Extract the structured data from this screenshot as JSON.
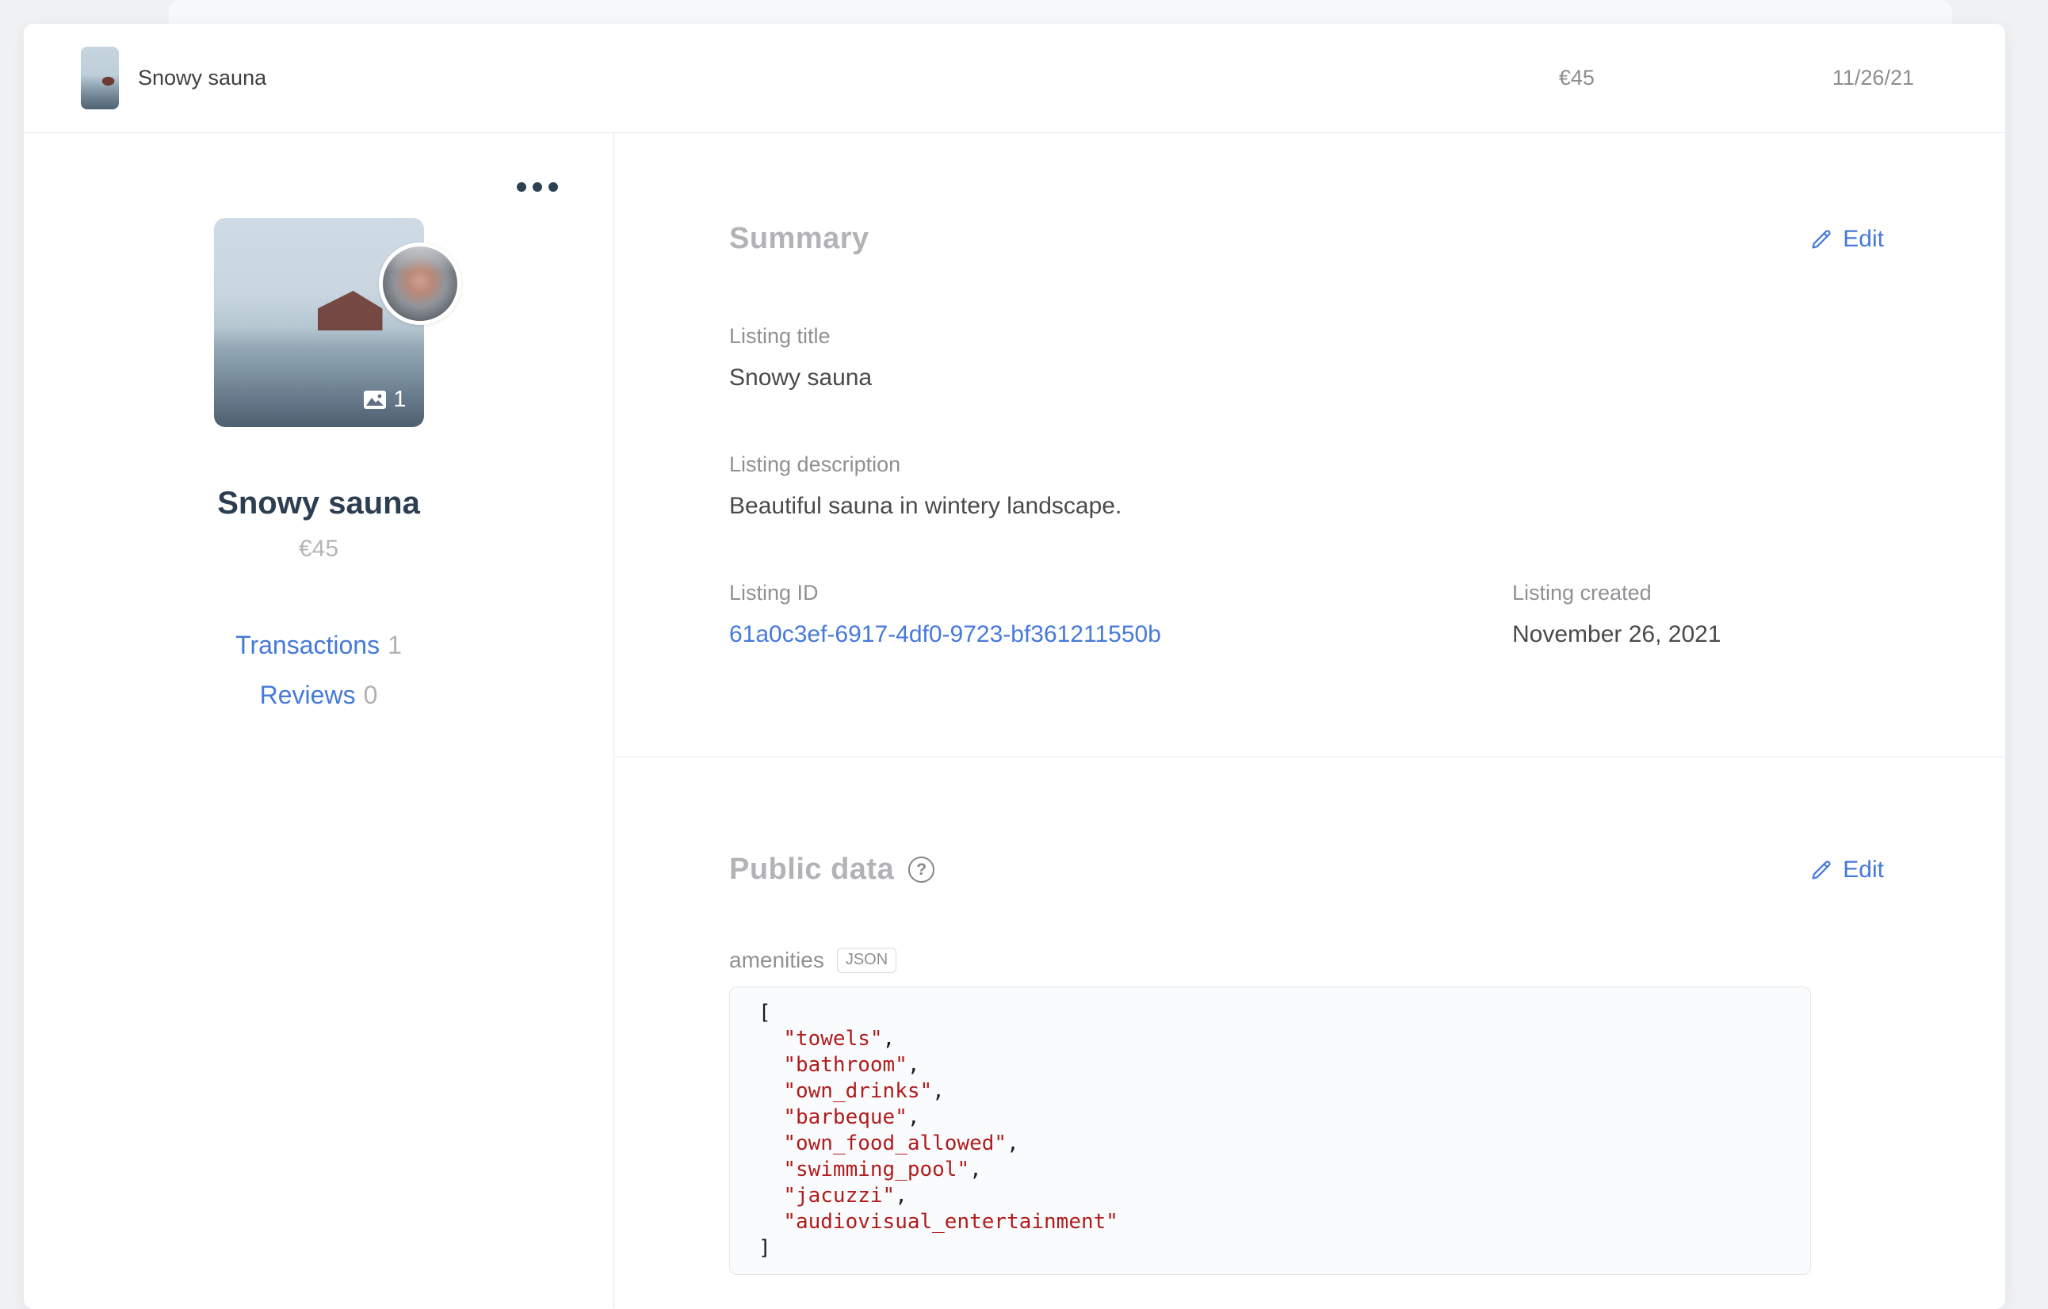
{
  "header": {
    "title": "Snowy sauna",
    "price": "€45",
    "date": "11/26/21"
  },
  "sidebar": {
    "image_count": "1",
    "title": "Snowy sauna",
    "price": "€45",
    "links": [
      {
        "label": "Transactions",
        "count": "1"
      },
      {
        "label": "Reviews",
        "count": "0"
      }
    ]
  },
  "summary": {
    "heading": "Summary",
    "edit_label": "Edit",
    "fields": {
      "listing_title": {
        "label": "Listing title",
        "value": "Snowy sauna"
      },
      "listing_description": {
        "label": "Listing description",
        "value": "Beautiful sauna in wintery landscape."
      },
      "listing_id": {
        "label": "Listing ID",
        "value": "61a0c3ef-6917-4df0-9723-bf361211550b"
      },
      "listing_created": {
        "label": "Listing created",
        "value": "November 26, 2021"
      }
    }
  },
  "public_data": {
    "heading": "Public data",
    "help_icon": "?",
    "edit_label": "Edit",
    "amenities": {
      "label": "amenities",
      "badge": "JSON",
      "values": [
        "towels",
        "bathroom",
        "own_drinks",
        "barbeque",
        "own_food_allowed",
        "swimming_pool",
        "jacuzzi",
        "audiovisual_entertainment"
      ]
    }
  },
  "colors": {
    "link_blue": "#4679d8",
    "accent_navy": "#2e4152",
    "string_red": "#b01c1c",
    "heading_gray": "#b3b3b7"
  }
}
